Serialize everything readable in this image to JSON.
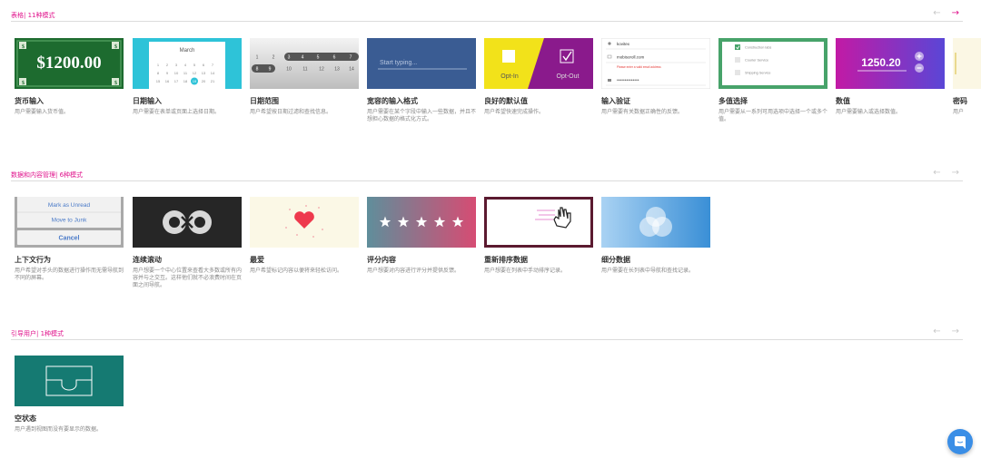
{
  "sections": [
    {
      "title": "表格| 11种模式",
      "cards": [
        {
          "title": "货币输入",
          "desc": "用户需要输入货币值。",
          "thumb_text": "$1200.00"
        },
        {
          "title": "日期输入",
          "desc": "用户需要在表单或页面上选择日期。",
          "thumb_text": "March"
        },
        {
          "title": "日期范围",
          "desc": "用户希望按日期过滤和查找信息。"
        },
        {
          "title": "宽容的输入格式",
          "desc": "用户需要在某个字段中输入一些数据，并且不想担心数据的格式化方式。",
          "thumb_text": "Start typing..."
        },
        {
          "title": "良好的默认值",
          "desc": "用户希望快速完成操作。",
          "thumb_left": "Opt-In",
          "thumb_right": "Opt-Out"
        },
        {
          "title": "输入验证",
          "desc": "用户需要有关数据正确性的反馈。",
          "thumb_user": "kovitex",
          "thumb_email": "mobisoroll.com",
          "thumb_error": "Please enter a valid email address"
        },
        {
          "title": "多值选择",
          "desc": "用户需要从一系列可用选项中选择一个或多个值。",
          "thumb_items": [
            "Construction labs",
            "Courier Service",
            "Shipping Service"
          ]
        },
        {
          "title": "数值",
          "desc": "用户需要输入或选择数值。",
          "thumb_text": "1250.20"
        },
        {
          "title": "密码",
          "desc": "用户"
        }
      ]
    },
    {
      "title": "数据和内容管理| 6种模式",
      "cards": [
        {
          "title": "上下文行为",
          "desc": "用户希望对手头的数据进行操作而无需导航到不同的屏幕。",
          "thumb_items": [
            "Mark as Unread",
            "Move to Junk",
            "Cancel"
          ]
        },
        {
          "title": "连续滚动",
          "desc": "用户想要一个中心位置来查看大多数或所有内容并与之交互。这样他们就不必浪费时间在页面之间导航。"
        },
        {
          "title": "最爱",
          "desc": "用户希望标记内容以便将来轻松访问。"
        },
        {
          "title": "评分内容",
          "desc": "用户想要对内容进行评分并提供反馈。",
          "thumb_stars": 5
        },
        {
          "title": "重新排序数据",
          "desc": "用户想要在列表中手动排序记录。"
        },
        {
          "title": "细分数据",
          "desc": "用户需要在长列表中导航和查找记录。"
        }
      ]
    },
    {
      "title": "引导用户| 1种模式",
      "cards": [
        {
          "title": "空状态",
          "desc": "用户遇到视图而没有要显示的数据。"
        }
      ]
    }
  ],
  "nav": {
    "prev": "←",
    "next": "→"
  },
  "colors": {
    "accent": "#e0138c",
    "chat": "#3a8ee6"
  },
  "icons": [
    "arrow-left-icon",
    "arrow-right-icon",
    "chat-icon",
    "user-icon",
    "mail-icon",
    "lock-icon",
    "check-icon",
    "plus-icon",
    "minus-icon",
    "heart-icon",
    "star-icon",
    "infinity-icon",
    "hand-cursor-icon",
    "inbox-icon"
  ]
}
